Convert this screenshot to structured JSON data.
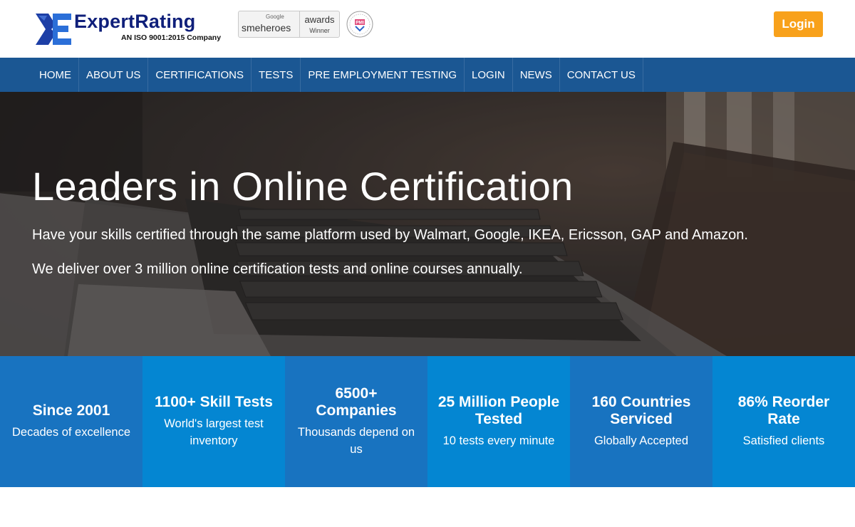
{
  "header": {
    "logo_name": "ExpertRating",
    "logo_tagline": "AN ISO 9001:2015 Company",
    "award_google": "Google",
    "award_smeheroes": "smeheroes",
    "award_awards": "awards",
    "award_winner": "Winner",
    "pmi_label": "PMI",
    "login_label": "Login"
  },
  "nav": {
    "items": [
      {
        "label": "HOME"
      },
      {
        "label": "ABOUT US"
      },
      {
        "label": "CERTIFICATIONS"
      },
      {
        "label": "TESTS"
      },
      {
        "label": "PRE EMPLOYMENT TESTING"
      },
      {
        "label": "LOGIN"
      },
      {
        "label": "NEWS"
      },
      {
        "label": "CONTACT US"
      }
    ]
  },
  "hero": {
    "title": "Leaders in Online Certification",
    "line1": "Have your skills certified through the same platform used by Walmart, Google, IKEA, Ericsson, GAP and Amazon.",
    "line2": "We deliver over 3 million online certification tests and online courses annually."
  },
  "stats": [
    {
      "title": "Since 2001",
      "sub": "Decades of excellence",
      "color": "#1873c0"
    },
    {
      "title": "1100+ Skill Tests",
      "sub": "World's largest test inventory",
      "color": "#0486d2"
    },
    {
      "title": "6500+ Companies",
      "sub": "Thousands depend on us",
      "color": "#1873c0"
    },
    {
      "title": "25 Million People Tested",
      "sub": "10 tests every minute",
      "color": "#0486d2"
    },
    {
      "title": "160 Countries Serviced",
      "sub": "Globally Accepted",
      "color": "#1873c0"
    },
    {
      "title": "86% Reorder Rate",
      "sub": "Satisfied clients",
      "color": "#0486d2"
    }
  ],
  "colors": {
    "nav_bg": "#1b5793",
    "login_bg": "#f8a11b",
    "logo_blue": "#0f1f7a"
  },
  "icons": {
    "logo_mark": "xe-logo-icon",
    "pmi_seal": "pmi-seal-icon"
  }
}
